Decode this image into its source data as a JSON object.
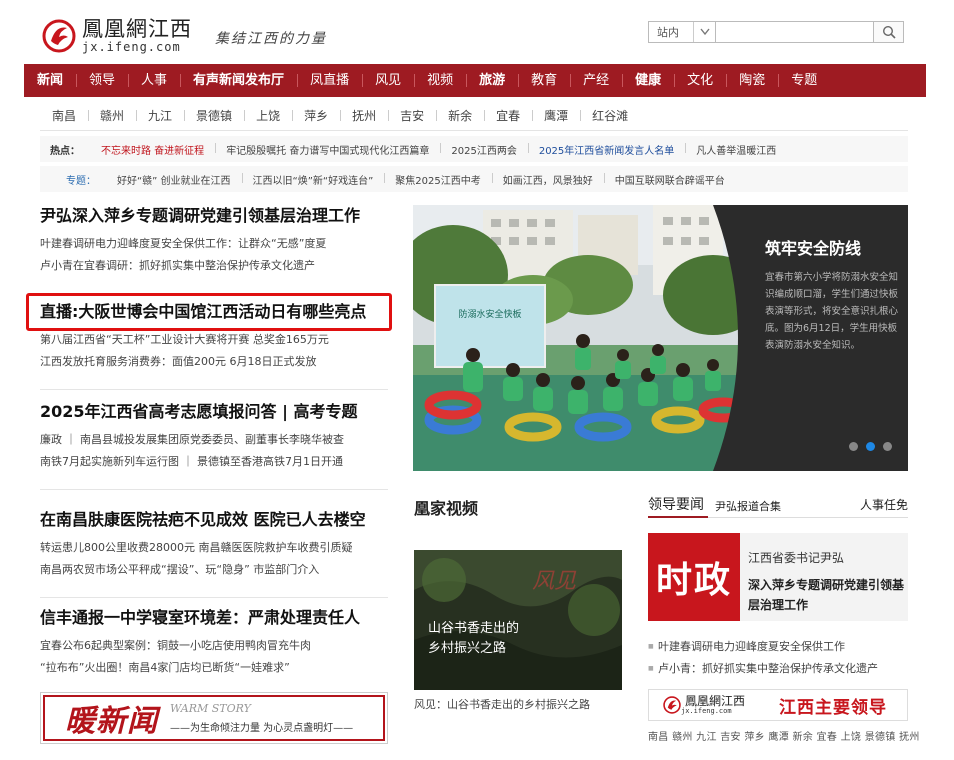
{
  "header": {
    "logo_title": "鳳凰網江西",
    "logo_domain": "jx.ifeng.com",
    "slogan": "集结江西的力量",
    "search_scope": "站内",
    "search_value": ""
  },
  "nav": [
    {
      "label": "新闻",
      "bold": true
    },
    {
      "label": "领导"
    },
    {
      "label": "人事"
    },
    {
      "label": "有声新闻发布厅",
      "bold": true
    },
    {
      "label": "凤直播"
    },
    {
      "label": "风见"
    },
    {
      "label": "视频"
    },
    {
      "label": "旅游",
      "bold": true
    },
    {
      "label": "教育"
    },
    {
      "label": "产经"
    },
    {
      "label": "健康",
      "bold": true
    },
    {
      "label": "文化"
    },
    {
      "label": "陶瓷"
    },
    {
      "label": "专题"
    }
  ],
  "cities": [
    "南昌",
    "赣州",
    "九江",
    "景德镇",
    "上饶",
    "萍乡",
    "抚州",
    "吉安",
    "新余",
    "宜春",
    "鹰潭",
    "红谷滩"
  ],
  "hot": {
    "label": "热点：",
    "items": [
      {
        "text": "不忘来时路 奋进新征程",
        "color": "red"
      },
      {
        "text": "牢记殷殷嘱托 奋力谱写中国式现代化江西篇章"
      },
      {
        "text": "2025江西两会"
      },
      {
        "text": "2025年江西省新闻发言人名单",
        "color": "blue"
      },
      {
        "text": "凡人善举温暖江西"
      }
    ]
  },
  "topics": {
    "label": "专题：",
    "items": [
      {
        "text": "好好“赣” 创业就业在江西"
      },
      {
        "text": "江西以旧“焕”新“好戏连台”"
      },
      {
        "text": "聚焦2025江西中考"
      },
      {
        "text": "如画江西，风景独好"
      },
      {
        "text": "中国互联网联合辟谣平台"
      }
    ]
  },
  "left": {
    "blocks": [
      {
        "headline": "尹弘深入萍乡专题调研党建引领基层治理工作",
        "subs": [
          "叶建春调研电力迎峰度夏安全保供工作：让群众“无感”度夏",
          "卢小青在宜春调研：抓好抓实集中整治保护传承文化遗产"
        ]
      },
      {
        "headline": "直播:大阪世博会中国馆江西活动日有哪些亮点",
        "subs": [
          "第八届江西省“天工杯”工业设计大赛将开赛 总奖金165万元",
          "江西发放托育服务消费券：面值200元 6月18日正式发放"
        ]
      },
      {
        "headline": "2025年江西省高考志愿填报问答 | 高考专题",
        "subs": [
          "廉政 ｜ 南昌县城投发展集团原党委委员、副董事长李晓华被查",
          "南铁7月起实施新列车运行图 ｜ 景德镇至香港高铁7月1日开通"
        ]
      },
      {
        "headline": "在南昌肤康医院祛疤不见成效 医院已人去楼空",
        "subs": [
          "转运患儿800公里收费28000元 南昌赣医医院救护车收费引质疑",
          "南昌两农贸市场公平秤成“摆设”、玩“隐身” 市监部门介入"
        ]
      },
      {
        "headline": "信丰通报一中学寝室环境差：严肃处理责任人",
        "subs": [
          "宜春公布6起典型案例：铜鼓一小吃店使用鸭肉冒充牛肉",
          "“拉布布”火出圈！南昌4家门店均已断货“一娃难求”"
        ]
      }
    ],
    "banner": {
      "title": "暖新闻",
      "en": "WARM STORY",
      "cn": "——为生命倾注力量 为心灵点盏明灯——"
    }
  },
  "hero": {
    "title": "筑牢安全防线",
    "desc": "宜春市第六小学将防溺水安全知识编成顺口溜，学生们通过快板表演等形式，将安全意识扎根心底。图为6月12日，学生用快板表演防溺水安全知识。",
    "board_text": "防溺水安全快板",
    "dots": 3,
    "active_dot": 1
  },
  "video": {
    "section_title": "凰家视频",
    "overlay_line1": "山谷书香走出的",
    "overlay_line2": "乡村振兴之路",
    "watermark": "风见",
    "caption": "风见：山谷书香走出的乡村振兴之路"
  },
  "leaders": {
    "tab_active": "领导要闻",
    "tab_sub": "尹弘报道合集",
    "tab_right": "人事任免",
    "card_badge": "时政",
    "card_name": "江西省委书记尹弘",
    "card_news": "深入萍乡专题调研党建引领基层治理工作",
    "list": [
      "叶建春调研电力迎峰度夏安全保供工作",
      "卢小青：抓好抓实集中整治保护传承文化遗产"
    ],
    "banner_logo": "鳳凰網江西",
    "banner_domain": "jx.ifeng.com",
    "banner_title": "江西主要领导",
    "city_footer": "南昌 赣州 九江 吉安 萍乡 鹰潭 新余 宜春 上饶 景德镇 抚州"
  },
  "colors": {
    "nav_bg": "#9e1b22",
    "brand_red": "#c8161d",
    "hero_bg": "#2b2b2b",
    "highlight": "#e01010"
  }
}
